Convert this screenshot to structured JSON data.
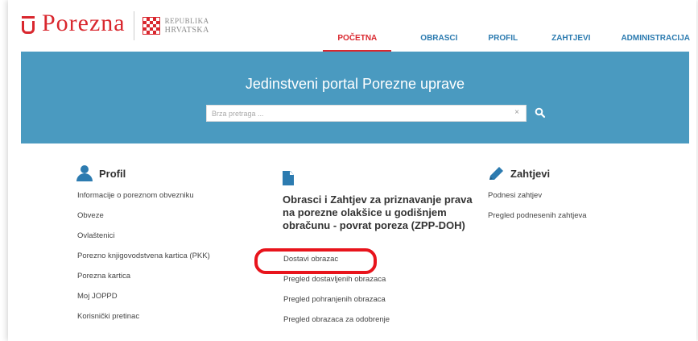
{
  "header": {
    "logo_text": "Porezna",
    "republic_line1": "REPUBLIKA",
    "republic_line2": "HRVATSKA",
    "nav": [
      "POČETNA",
      "OBRASCI",
      "PROFIL",
      "ZAHTJEVI",
      "ADMINISTRACIJA"
    ],
    "active_nav": "POČETNA"
  },
  "banner": {
    "title": "Jedinstveni portal Porezne uprave",
    "search_placeholder": "Brza pretraga ...",
    "clear_symbol": "×"
  },
  "profil": {
    "title": "Profil",
    "links": [
      "Informacije o poreznom obvezniku",
      "Obveze",
      "Ovlaštenici",
      "Porezno knjigovodstvena kartica (PKK)",
      "Porezna kartica",
      "Moj JOPPD",
      "Korisnički pretinac"
    ]
  },
  "obrasci": {
    "title": "Obrasci i Zahtjev za priznavanje prava na porezne olakšice u godišnjem obračunu - povrat poreza (ZPP-DOH)",
    "links": [
      "Dostavi obrazac",
      "Pregled dostavljenih obrazaca",
      "Pregled pohranjenih obrazaca",
      "Pregled obrazaca za odobrenje"
    ]
  },
  "zahtjevi": {
    "title": "Zahtjevi",
    "links": [
      "Podnesi zahtjev",
      "Pregled podnesenih zahtjeva"
    ]
  },
  "colors": {
    "brand_red": "#d9272e",
    "link_blue": "#2c7bb0",
    "banner_blue": "#4a9ac0",
    "highlight_red": "#e8141c"
  },
  "icons": [
    "person-icon",
    "document-icon",
    "pencil-icon",
    "search-icon",
    "croatian-checkerboard-icon"
  ]
}
